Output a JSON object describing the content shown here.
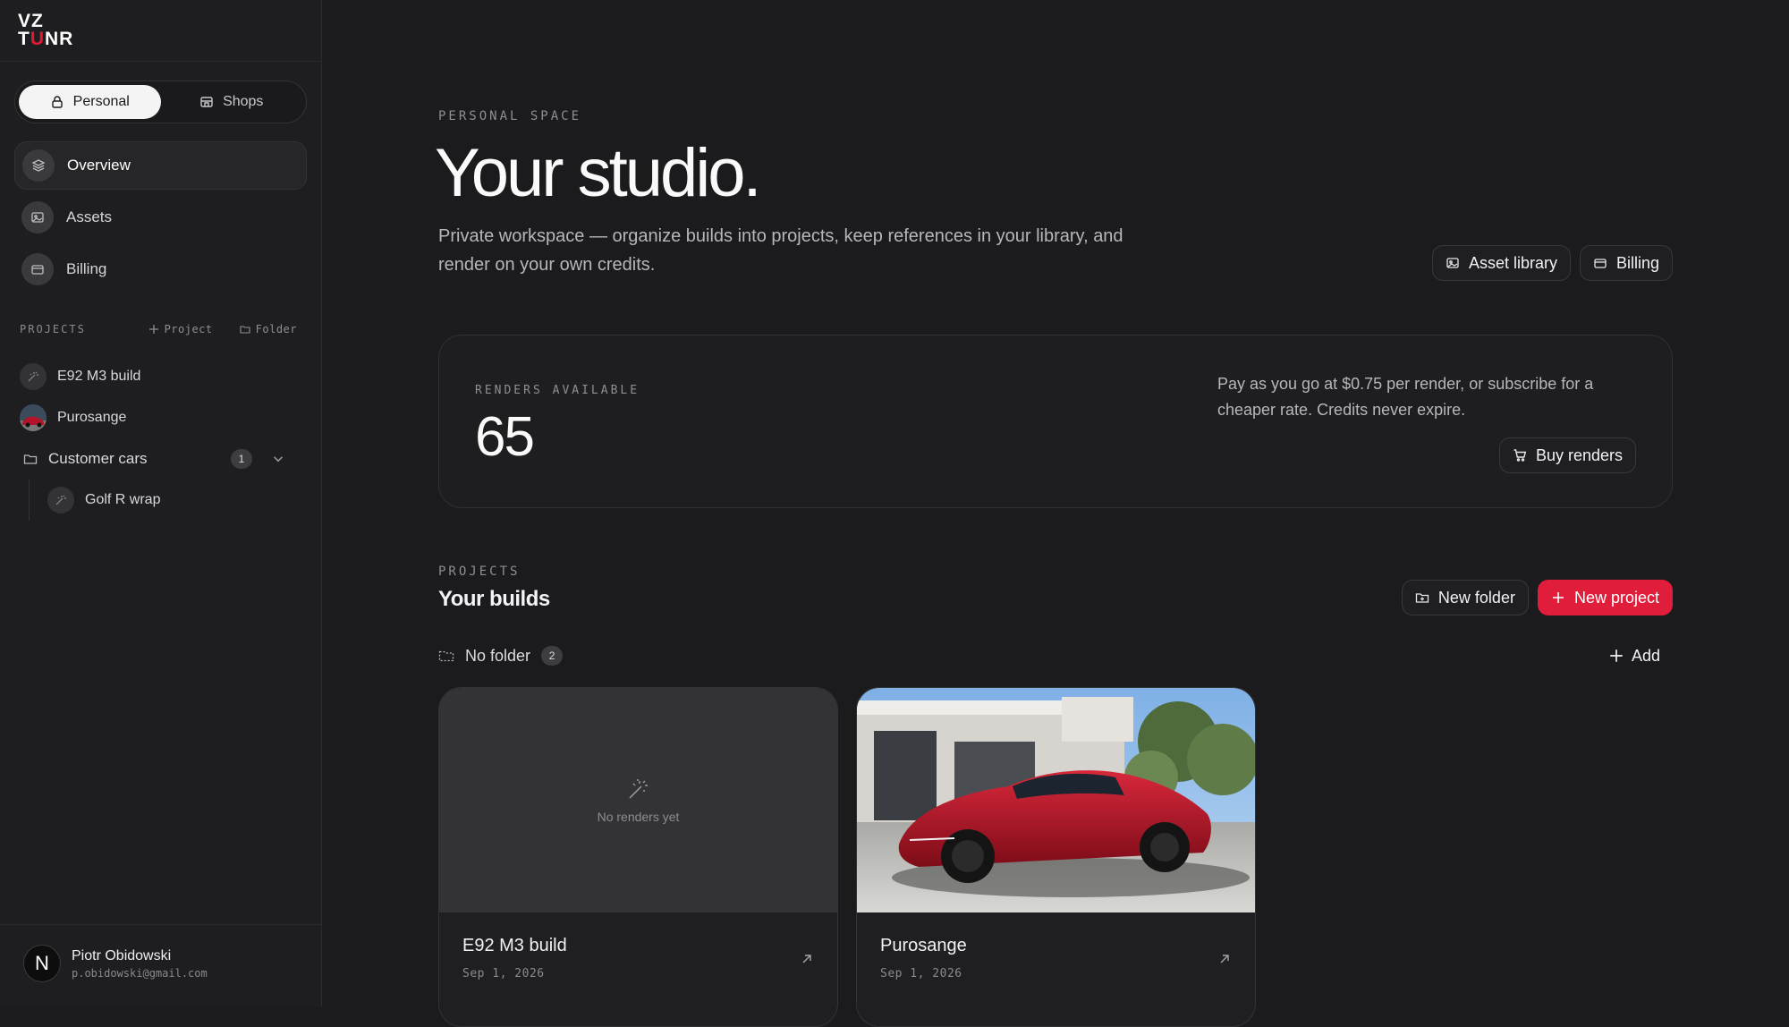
{
  "brand": {
    "logo_line1": "VZ",
    "logo_line2_a": "T",
    "logo_line2_b": "U",
    "logo_line2_c": "NR"
  },
  "space_toggle": {
    "personal": "Personal",
    "shops": "Shops"
  },
  "nav": [
    {
      "label": "Overview",
      "icon": "layers-icon"
    },
    {
      "label": "Assets",
      "icon": "image-icon"
    },
    {
      "label": "Billing",
      "icon": "card-icon"
    }
  ],
  "sidebar_projects": {
    "heading": "PROJECTS",
    "add_project": "Project",
    "add_folder": "Folder",
    "items": [
      {
        "name": "E92 M3 build"
      },
      {
        "name": "Purosange"
      }
    ],
    "folder": {
      "name": "Customer cars",
      "count": "1",
      "items": [
        {
          "name": "Golf R wrap"
        }
      ]
    }
  },
  "user": {
    "name": "Piotr Obidowski",
    "email": "p.obidowski@gmail.com",
    "initial": "N"
  },
  "header": {
    "eyebrow": "PERSONAL SPACE",
    "title": "Your studio.",
    "description": "Private workspace — organize builds into projects, keep references in your library, and render on your own credits.",
    "asset_library": "Asset library",
    "billing": "Billing"
  },
  "credits": {
    "label": "RENDERS AVAILABLE",
    "value": "65",
    "info": "Pay as you go at $0.75 per render, or subscribe for a cheaper rate. Credits never expire.",
    "buy": "Buy renders"
  },
  "builds": {
    "eyebrow": "PROJECTS",
    "title": "Your builds",
    "new_folder": "New folder",
    "new_project": "New project",
    "folder_label": "No folder",
    "folder_count": "2",
    "add": "Add",
    "cards": [
      {
        "title": "E92 M3 build",
        "date": "Sep 1, 2026",
        "placeholder": "No renders yet"
      },
      {
        "title": "Purosange",
        "date": "Sep 1, 2026"
      }
    ]
  },
  "colors": {
    "accent": "#e11d3c",
    "background": "#1b1b1d",
    "sidebar": "#1e1e20"
  }
}
